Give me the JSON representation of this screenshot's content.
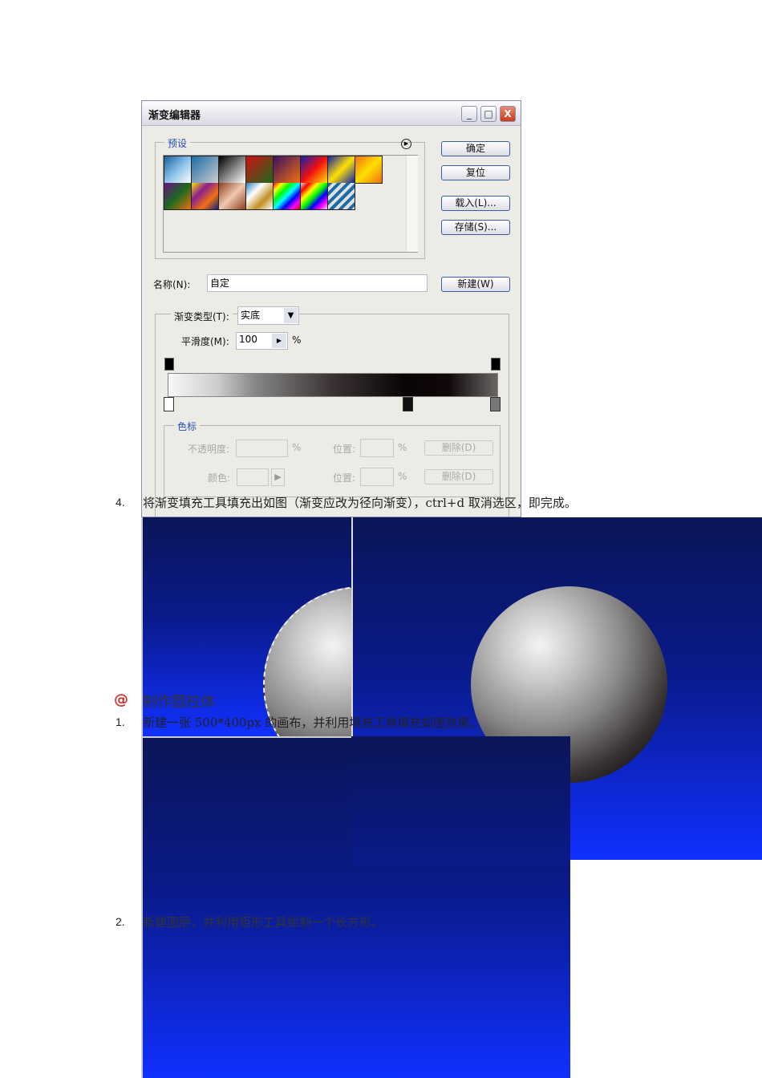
{
  "dialog": {
    "title": "渐变编辑器",
    "window_buttons": {
      "minimize": "_",
      "maximize": "□",
      "close": "X"
    },
    "presets_label": "预设",
    "buttons": {
      "ok": "确定",
      "reset": "复位",
      "load": "载入(L)...",
      "save": "存储(S)...",
      "new": "新建(W)"
    },
    "name_label": "名称(N):",
    "name_value": "自定",
    "gradient_type_label": "渐变类型(T):",
    "gradient_type_value": "实底",
    "smoothness_label": "平滑度(M):",
    "smoothness_value": "100",
    "percent": "%",
    "stops_label": "色标",
    "opacity_label": "不透明度:",
    "position_label": "位置:",
    "delete_label": "删除(D)",
    "color_label": "颜色:"
  },
  "doc": {
    "step4_num": "4.",
    "step4_text": "将渐变填充工具填充出如图（渐变应改为径向渐变），ctrl+d 取消选区，即完成。",
    "section_title": "制作圆柱体",
    "step1_num": "1.",
    "step1_text": "新建一张 500*400px 的画布，并利用填充工具填充如图效果。",
    "step2_num": "2.",
    "step2_text": "新建图层，并利用矩形工具绘制一个长方形。"
  }
}
